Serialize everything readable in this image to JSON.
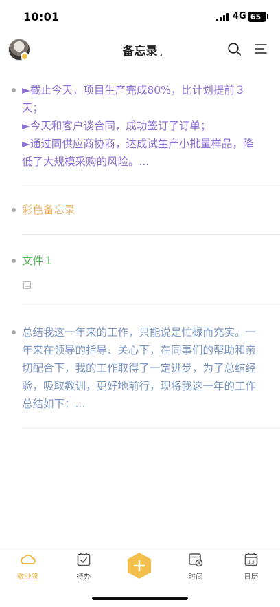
{
  "status_bar": {
    "time": "10:01",
    "network": "4G",
    "battery": "65"
  },
  "header": {
    "title": "备忘录"
  },
  "notes": [
    {
      "lines": [
        "►截止今天，项目生产完成80%，比计划提前３",
        "天；",
        "►今天和客户谈合同，成功签订了订单；",
        "►通过同供应商协商，达成试生产小批量样品，降",
        "低了大规模采购的风险。..."
      ]
    },
    {
      "lines": [
        "彩色备忘录"
      ]
    },
    {
      "lines": [
        "文件１"
      ]
    },
    {
      "lines": [
        "总结我这一年来的工作，只能说是忙碌而充实。一",
        "年来在领导的指导、关心下，在同事们的帮助和亲",
        "切配合下，我的工作取得了一定进步，为了总结经",
        "验，吸取教训，更好地前行，现将我这一年的工作",
        "总结如下：..."
      ]
    }
  ],
  "tabbar": {
    "tabs": [
      {
        "label": "敬业签",
        "icon": "cloud-icon"
      },
      {
        "label": "待办",
        "icon": "todo-icon"
      },
      {
        "label": "",
        "icon": "add-icon"
      },
      {
        "label": "时间",
        "icon": "time-icon"
      },
      {
        "label": "日历",
        "icon": "calendar-icon"
      }
    ],
    "calendar_day": "13"
  },
  "colors": {
    "accent": "#efb43a",
    "purple_note": "#8c6fd3",
    "orange_note": "#e5b36a",
    "green_note": "#5ab55a",
    "blue_note": "#7a95c0"
  }
}
